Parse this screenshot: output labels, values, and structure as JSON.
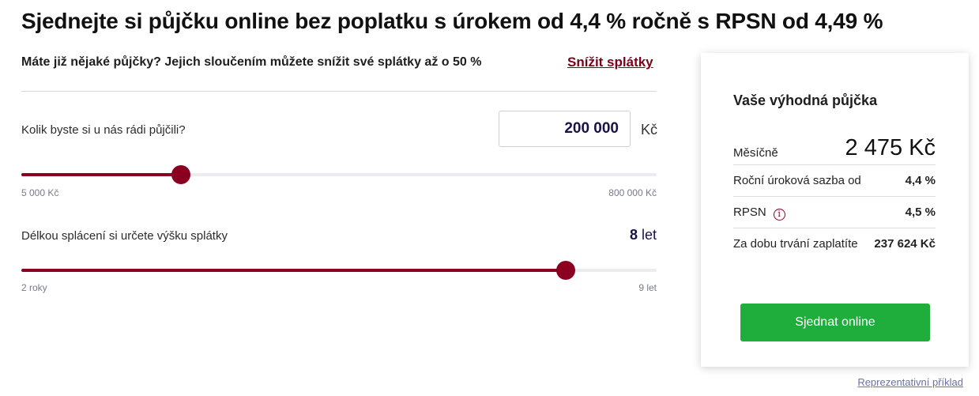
{
  "headline": "Sjednejte si půjčku online bez poplatku s úrokem od 4,4 % ročně s RPSN od 4,49 %",
  "promo": {
    "text": "Máte již nějaké půjčky? Jejich sloučením můžete snížit své splátky až o 50 %",
    "link": "Snížit splátky"
  },
  "amount": {
    "question": "Kolik byste si u nás rádi půjčili?",
    "value": "200 000",
    "unit": "Kč",
    "min_label": "5 000 Kč",
    "max_label": "800 000 Kč",
    "slider_fraction": 0.2516
  },
  "term": {
    "question": "Délkou splácení si určete výšku splátky",
    "value": "8",
    "unit": "let",
    "min_label": "2 roky",
    "max_label": "9 let",
    "slider_fraction": 0.8571
  },
  "card": {
    "title": "Vaše výhodná půjčka",
    "monthly_label": "Měsíčně",
    "monthly_value": "2 475 Kč",
    "rate_label": "Roční úroková sazba od",
    "rate_value": "4,4 %",
    "rpsn_label": "RPSN",
    "rpsn_icon": "info-icon",
    "rpsn_value": "4,5 %",
    "total_label": "Za dobu trvání zaplatíte",
    "total_value": "237 624 Kč",
    "cta": "Sjednat online"
  },
  "footer_link": "Reprezentativní příklad",
  "colors": {
    "accent": "#8b0020",
    "link": "#7d0018",
    "cta": "#1fae3b",
    "value_text": "#16124a"
  }
}
